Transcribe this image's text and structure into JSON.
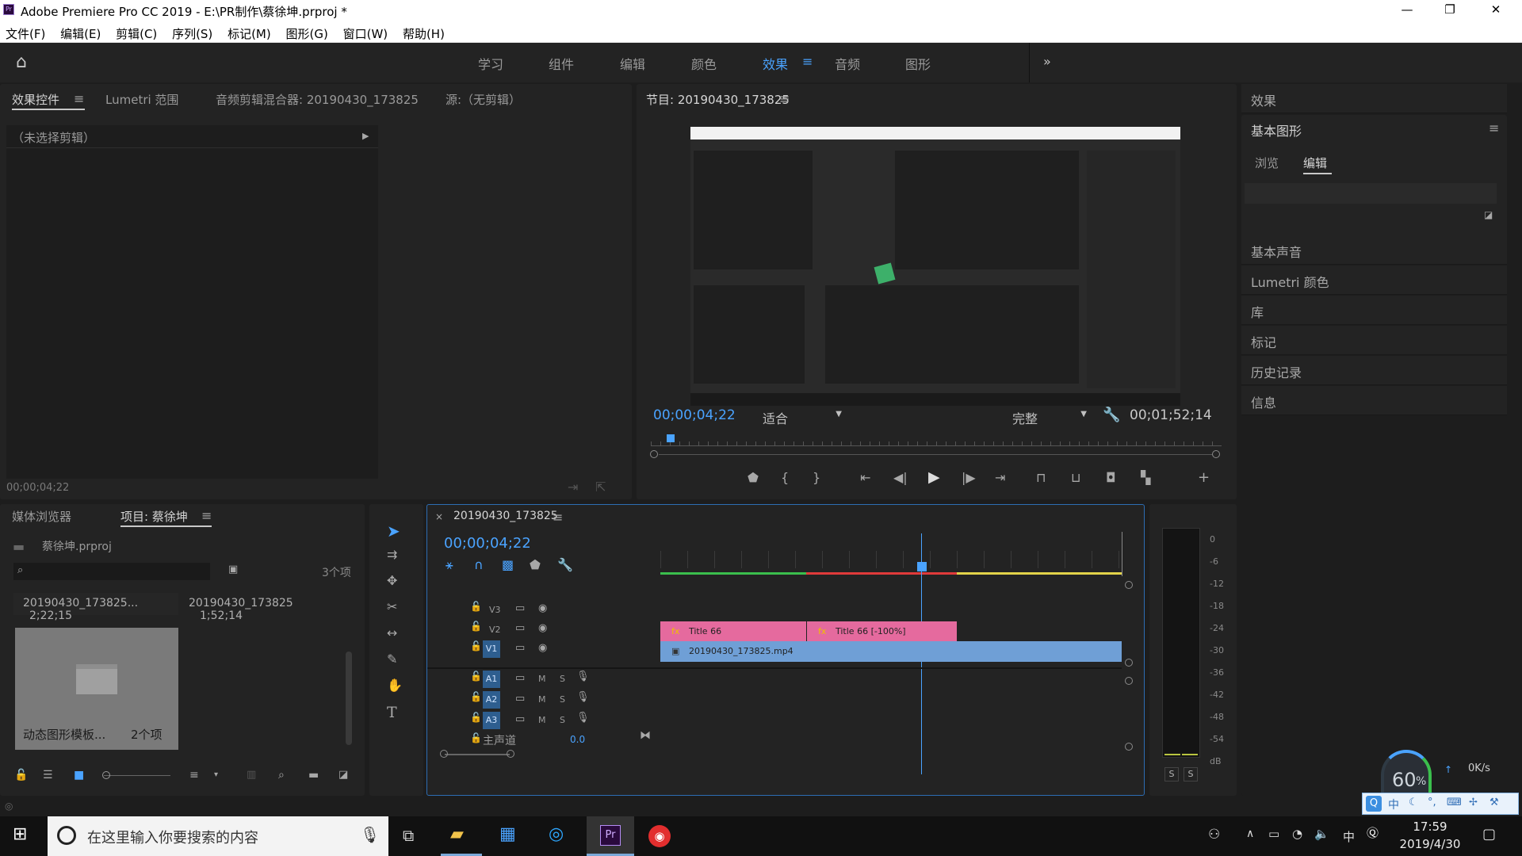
{
  "window": {
    "title": "Adobe Premiere Pro CC 2019 - E:\\PR制作\\蔡徐坤.prproj *",
    "app_icon": "Pr",
    "controls": [
      "—",
      "❐",
      "✕"
    ]
  },
  "menu": [
    "文件(F)",
    "编辑(E)",
    "剪辑(C)",
    "序列(S)",
    "标记(M)",
    "图形(G)",
    "窗口(W)",
    "帮助(H)"
  ],
  "workspaces": {
    "items": [
      "学习",
      "组件",
      "编辑",
      "颜色",
      "效果",
      "音频",
      "图形"
    ],
    "active": "效果",
    "more": "»"
  },
  "source_panel": {
    "tabs": [
      "效果控件",
      "Lumetri 范围",
      "音频剪辑混合器: 20190430_173825",
      "源:（无剪辑）"
    ],
    "active_tab": "效果控件",
    "no_clip": "（未选择剪辑）",
    "timecode": "00;00;04;22"
  },
  "program_monitor": {
    "title": "节目: 20190430_173825",
    "timecode": "00;00;04;22",
    "fit": "适合",
    "quality": "完整",
    "duration": "00;01;52;14"
  },
  "right_panel": {
    "effects": "效果",
    "essential_graphics": "基本图形",
    "eg_tabs": [
      "浏览",
      "编辑"
    ],
    "eg_active": "编辑",
    "items": [
      "基本声音",
      "Lumetri 颜色",
      "库",
      "标记",
      "历史记录",
      "信息"
    ]
  },
  "project_panel": {
    "tabs": [
      "媒体浏览器",
      "项目: 蔡徐坤"
    ],
    "active_tab": "项目: 蔡徐坤",
    "file": "蔡徐坤.prproj",
    "count": "3个项",
    "items": [
      {
        "name": "20190430_173825...",
        "duration": "2;22;15"
      },
      {
        "name": "20190430_173825",
        "duration": "1;52;14"
      }
    ],
    "folder": {
      "name": "动态图形模板...",
      "count": "2个项"
    }
  },
  "timeline": {
    "sequence": "20190430_173825",
    "timecode": "00;00;04;22",
    "video_tracks": [
      "V3",
      "V2",
      "V1"
    ],
    "audio_tracks": [
      "A1",
      "A2",
      "A3"
    ],
    "master": "主声道",
    "master_value": "0.0",
    "clips": {
      "title1": "Title 66",
      "title2": "Title 66 [-100%]",
      "video": "20190430_173825.mp4"
    },
    "m": "M",
    "s": "S"
  },
  "audio_meter": {
    "scale": [
      "0",
      "-6",
      "-12",
      "-18",
      "-24",
      "-30",
      "-36",
      "-42",
      "-48",
      "-54",
      "dB"
    ],
    "solo": [
      "S",
      "S"
    ]
  },
  "overlay": {
    "cpu": "60",
    "cpu_unit": "%",
    "speed": "0K/s"
  },
  "taskbar": {
    "search_placeholder": "在这里输入你要搜索的内容",
    "time": "17:59",
    "date": "2019/4/30",
    "ime": "中"
  },
  "colors": {
    "accent": "#4aa3ff",
    "title_clip": "#e56a9e",
    "video_clip": "#6f9fd6",
    "track_active": "#2e5e8f"
  }
}
